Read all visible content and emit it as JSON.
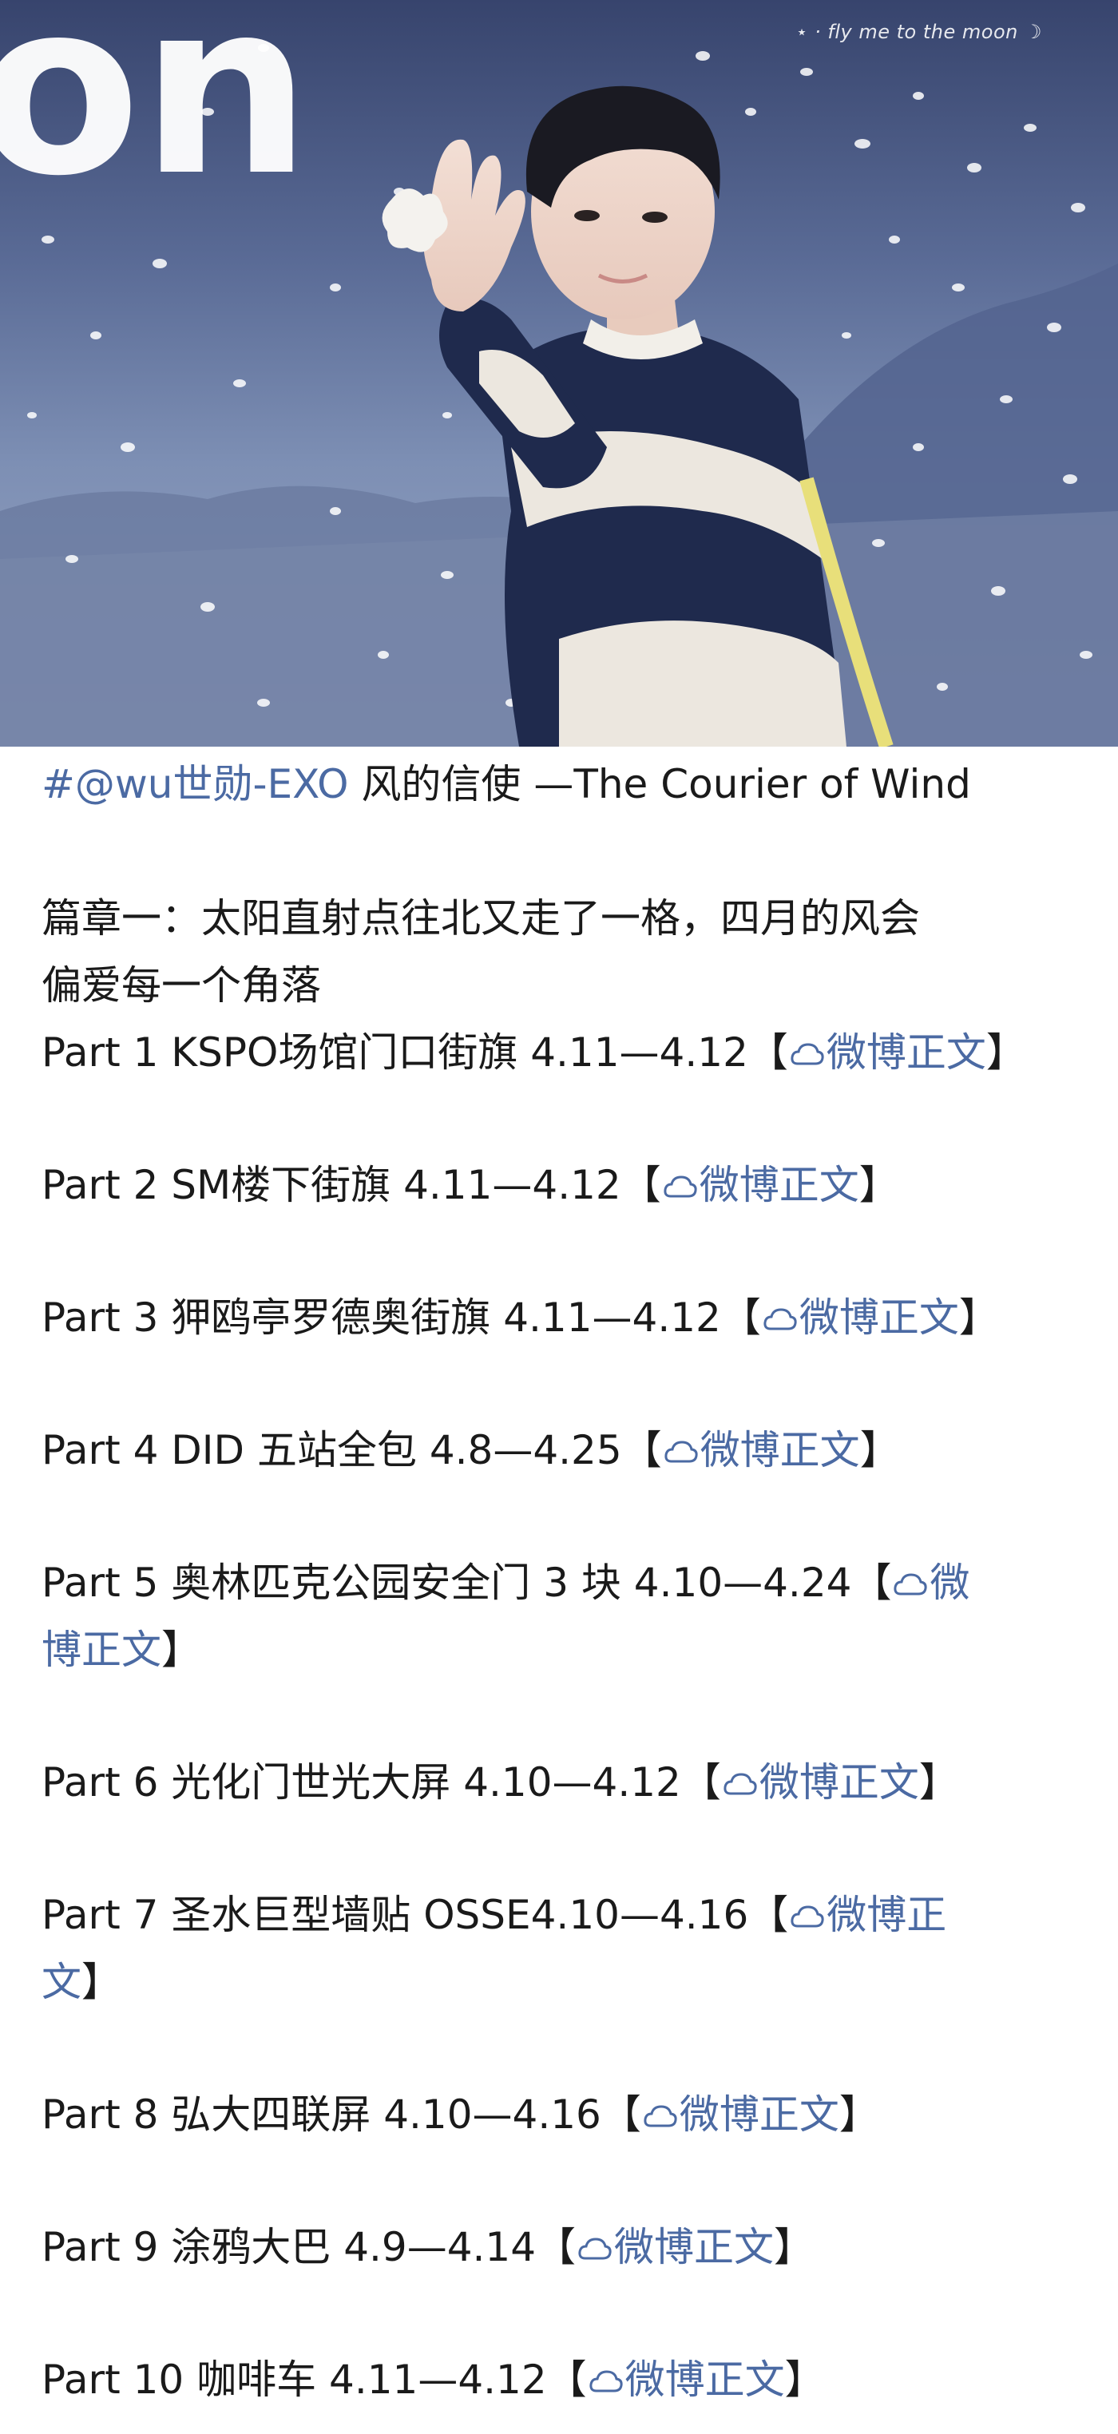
{
  "hero": {
    "watermark": "⋆ · fly me to the moon ☽",
    "background_text": "on",
    "image_description_icon": "person-waving-photo"
  },
  "post": {
    "hashtag": "#@wu世勋-EXO",
    "title_rest": "风的信使 —The Courier of Wind",
    "chapter_line1": "篇章一：太阳直射点往北又走了一格，四月的风会",
    "chapter_line2": "偏爱每一个角落",
    "link_text": "微博正文",
    "bracket_open": "【",
    "bracket_close": "】",
    "parts": [
      {
        "label": "Part 1  KSPO场馆门口街旗 4.11—4.12"
      },
      {
        "label": "Part 2 SM楼下街旗 4.11—4.12"
      },
      {
        "label": "Part 3 狎鸥亭罗德奥街旗 4.11—4.12"
      },
      {
        "label": "Part 4  DID 五站全包 4.8—4.25"
      },
      {
        "label": "Part 5  奥林匹克公园安全门 3 块  4.10—4.24",
        "link_line1": "微",
        "link_line2": "博正文"
      },
      {
        "label": "Part 6  光化门世光大屏 4.10—4.12"
      },
      {
        "label": "Part 7  圣水巨型墙贴 OSSE4.10—4.16",
        "link_line1": "微博正",
        "link_line2": "文"
      },
      {
        "label": "Part 8  弘大四联屏 4.10—4.16"
      },
      {
        "label": "Part 9  涂鸦大巴 4.9—4.14"
      },
      {
        "label": "Part 10  咖啡车 4.11—4.12"
      }
    ]
  },
  "colors": {
    "link": "#4b6aa3",
    "text": "#1a1a1a",
    "sky": "#6f82a9"
  }
}
